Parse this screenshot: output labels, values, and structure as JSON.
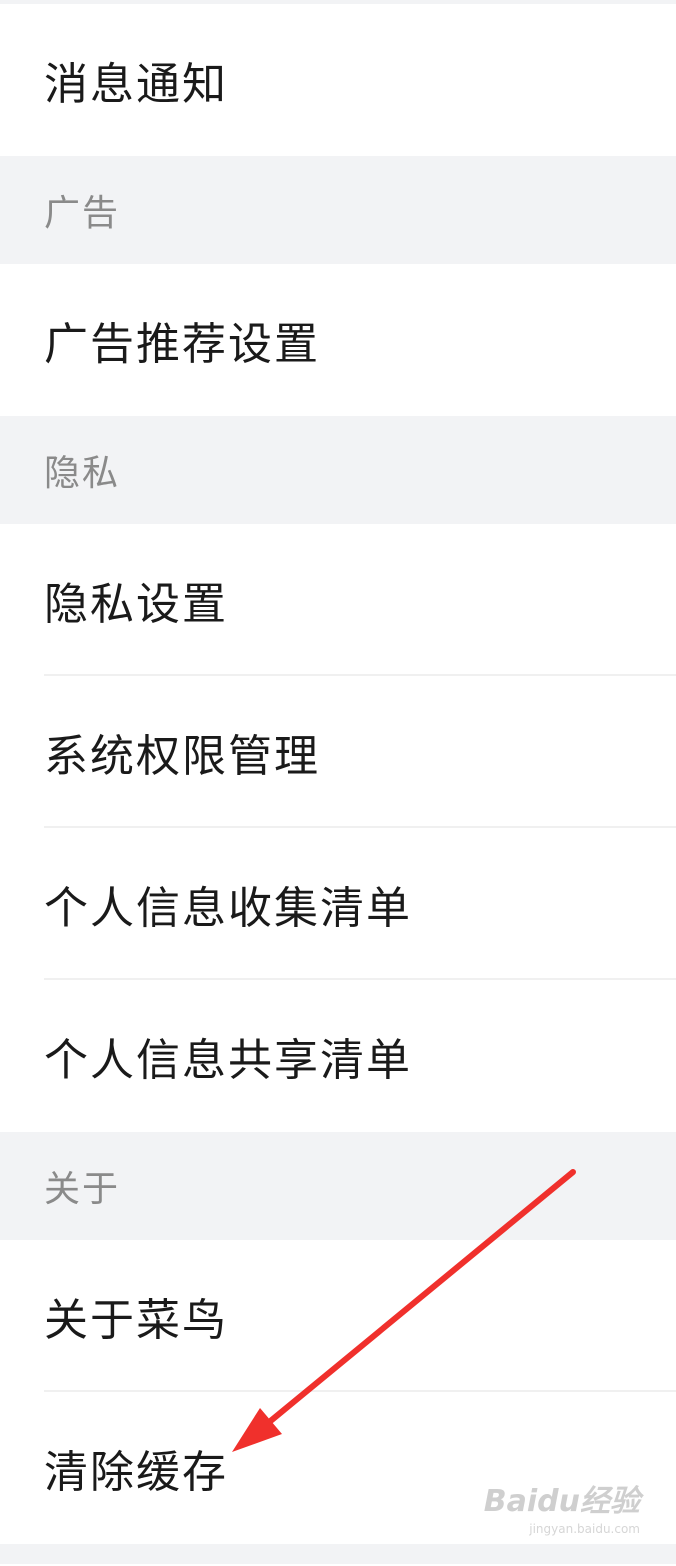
{
  "colors": {
    "background": "#ffffff",
    "section_background": "#f2f3f5",
    "primary_text": "#1a1a1a",
    "section_text": "#8a8a8a",
    "divider": "#f0f0f0",
    "annotation_arrow": "#f0302c"
  },
  "settings": {
    "notification_item": "消息通知",
    "ads_section": {
      "header": "广告",
      "items": [
        "广告推荐设置"
      ]
    },
    "privacy_section": {
      "header": "隐私",
      "items": [
        "隐私设置",
        "系统权限管理",
        "个人信息收集清单",
        "个人信息共享清单"
      ]
    },
    "about_section": {
      "header": "关于",
      "items": [
        "关于菜鸟",
        "清除缓存"
      ]
    }
  },
  "watermark": {
    "main": "Baidu经验",
    "sub": "jingyan.baidu.com"
  }
}
